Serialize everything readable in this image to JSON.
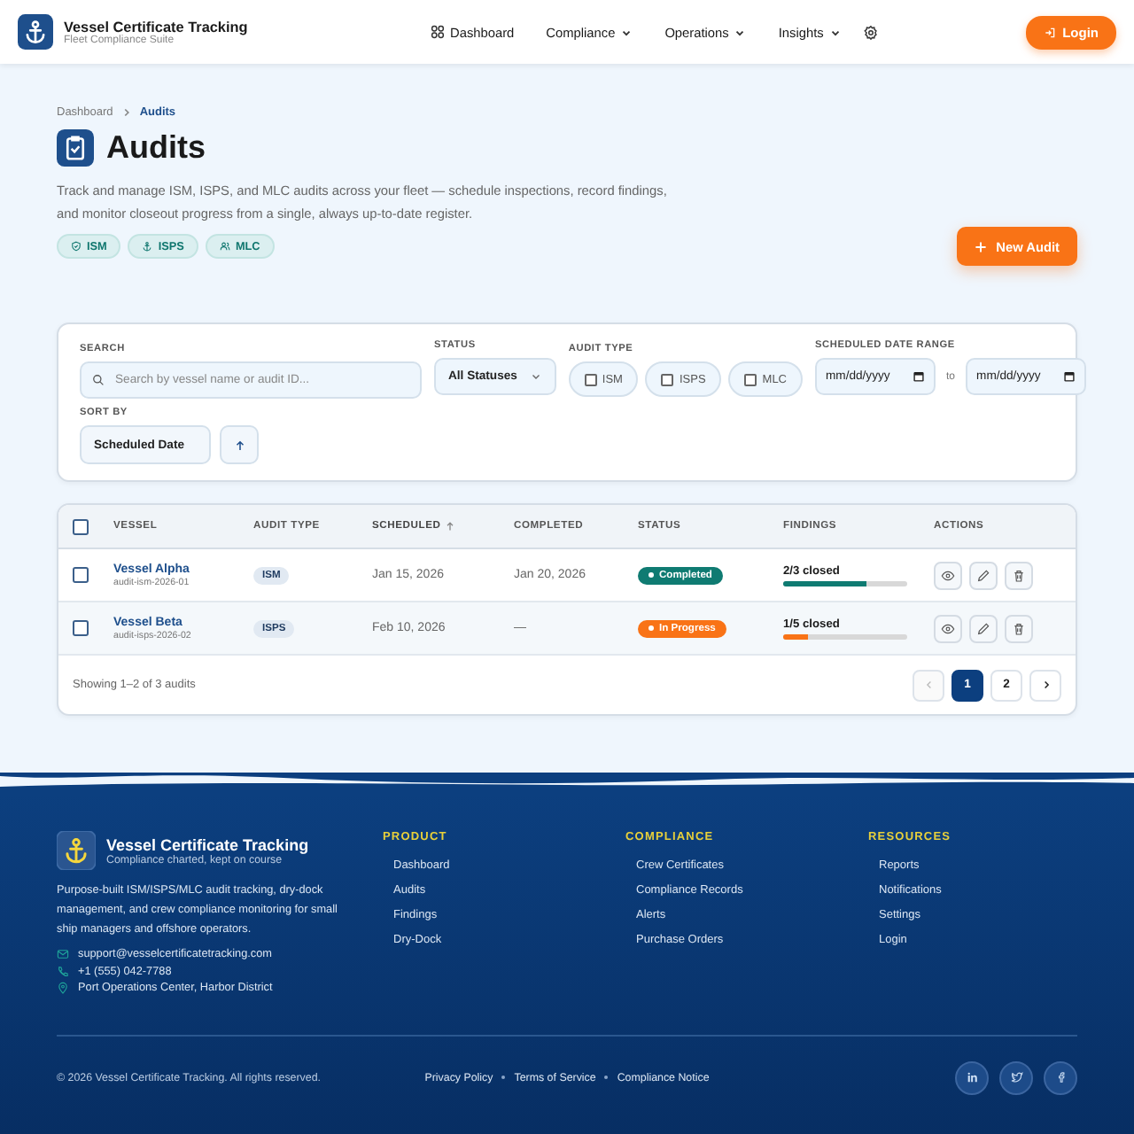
{
  "header": {
    "brand": "Vessel Certificate Tracking",
    "tagline": "Fleet Compliance Suite",
    "nav": [
      {
        "label": "Dashboard",
        "kind": "link"
      },
      {
        "label": "Compliance",
        "kind": "dropdown"
      },
      {
        "label": "Operations",
        "kind": "dropdown"
      },
      {
        "label": "Insights",
        "kind": "dropdown"
      }
    ],
    "login": "Login"
  },
  "breadcrumb": [
    {
      "label": "Dashboard",
      "current": false
    },
    {
      "label": "Audits",
      "current": true
    }
  ],
  "page": {
    "title": "Audits",
    "description": "Track and manage ISM, ISPS, and MLC audits across your fleet — schedule inspections, record findings, and monitor closeout progress from a single, always up-to-date register.",
    "tags": [
      {
        "label": "ISM",
        "kind": "shield"
      },
      {
        "label": "ISPS",
        "kind": "anchor"
      },
      {
        "label": "MLC",
        "kind": "people"
      }
    ],
    "new_button": "New Audit"
  },
  "filters": {
    "search": {
      "label": "SEARCH",
      "placeholder": "Search by vessel name or audit ID..."
    },
    "status": {
      "label": "STATUS",
      "value": "All Statuses"
    },
    "audit_type": {
      "label": "AUDIT TYPE",
      "options": [
        {
          "label": "ISM",
          "checked": false
        },
        {
          "label": "ISPS",
          "checked": false
        },
        {
          "label": "MLC",
          "checked": false
        }
      ]
    },
    "date_range": {
      "label": "SCHEDULED DATE RANGE",
      "from": "mm/dd/yyyy",
      "to_label": "to",
      "to": "mm/dd/yyyy"
    },
    "sort": {
      "label": "SORT BY",
      "value": "Scheduled Date"
    }
  },
  "table": {
    "all_checked": false,
    "columns": [
      {
        "label": "VESSEL",
        "sorted": false
      },
      {
        "label": "AUDIT TYPE",
        "sorted": false
      },
      {
        "label": "SCHEDULED",
        "sorted": true
      },
      {
        "label": "COMPLETED",
        "sorted": false
      },
      {
        "label": "STATUS",
        "sorted": false
      },
      {
        "label": "FINDINGS",
        "sorted": false
      },
      {
        "label": "ACTIONS",
        "sorted": false
      }
    ],
    "rows": [
      {
        "checked": false,
        "vessel": "Vessel Alpha",
        "id": "audit-ism-2026-01",
        "type": "ISM",
        "scheduled": "Jan 15, 2026",
        "completed": "Jan 20, 2026",
        "status": "Completed",
        "color": "#0f7b72",
        "findings": "2/3 closed",
        "level": 0.67
      },
      {
        "checked": false,
        "vessel": "Vessel Beta",
        "id": "audit-isps-2026-02",
        "type": "ISPS",
        "scheduled": "Feb 10, 2026",
        "completed": "—",
        "status": "In Progress",
        "color": "#f97316",
        "findings": "1/5 closed",
        "level": 0.2
      }
    ],
    "showing": "Showing 1–2 of 3 audits",
    "pages": [
      {
        "label": "1",
        "selected": true
      },
      {
        "label": "2",
        "selected": false
      }
    ]
  },
  "footer": {
    "brand": "Vessel Certificate Tracking",
    "tagline": "Compliance charted, kept on course",
    "description": "Purpose-built ISM/ISPS/MLC audit tracking, dry-dock management, and crew compliance monitoring for small ship managers and offshore operators.",
    "contacts": [
      {
        "kind": "mail",
        "text": "support@vesselcertificatetracking.com"
      },
      {
        "kind": "phone",
        "text": "+1 (555) 042-7788"
      },
      {
        "kind": "pin",
        "text": "Port Operations Center, Harbor District"
      }
    ],
    "columns": [
      {
        "title": "PRODUCT",
        "links": [
          "Dashboard",
          "Audits",
          "Findings",
          "Dry-Dock"
        ]
      },
      {
        "title": "COMPLIANCE",
        "links": [
          "Crew Certificates",
          "Compliance Records",
          "Alerts",
          "Purchase Orders"
        ]
      },
      {
        "title": "RESOURCES",
        "links": [
          "Reports",
          "Notifications",
          "Settings",
          "Login"
        ]
      }
    ],
    "copyright": "© 2026 Vessel Certificate Tracking. All rights reserved.",
    "legal": [
      "Privacy Policy",
      "Terms of Service",
      "Compliance Notice"
    ],
    "socials": [
      {
        "kind": "linkedin"
      },
      {
        "kind": "twitter"
      },
      {
        "kind": "facebook"
      }
    ]
  }
}
